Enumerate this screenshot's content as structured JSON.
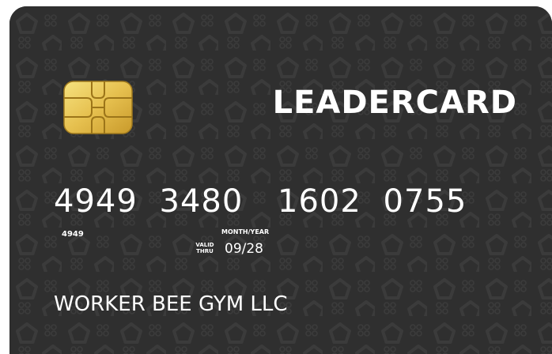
{
  "card": {
    "brand": "LEADERCARD",
    "number_groups": [
      "4949",
      "3480",
      "1602",
      "0755"
    ],
    "small_number": "4949",
    "month_year_label": "MONTH/YEAR",
    "valid_label": "VALID",
    "thru_label": "THRU",
    "expiry": "09/28",
    "holder_name": "WORKER BEE GYM LLC",
    "colors": {
      "card_background": "#2f2f2f",
      "pattern": "#393939",
      "text": "#ffffff",
      "chip_gold": "#e7c45a"
    },
    "icons": [
      "emv-chip-icon",
      "pentagon-pattern"
    ]
  }
}
